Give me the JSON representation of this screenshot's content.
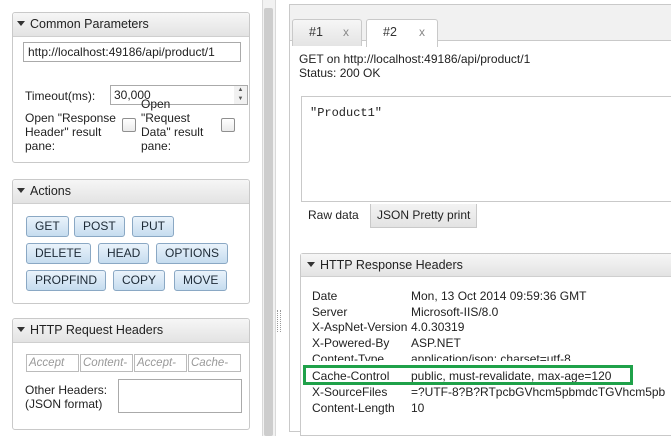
{
  "common": {
    "title": "Common Parameters",
    "url_value": "http://localhost:49186/api/product/1",
    "timeout_label": "Timeout(ms):",
    "timeout_value": "30,000",
    "open_response_header_label": [
      "Open \"Response",
      "Header\" result",
      "pane:"
    ],
    "open_request_data_label": [
      "Open",
      "\"Request",
      "Data\" result",
      "pane:"
    ]
  },
  "actions": {
    "title": "Actions",
    "buttons": [
      "GET",
      "POST",
      "PUT",
      "DELETE",
      "HEAD",
      "OPTIONS",
      "PROPFIND",
      "COPY",
      "MOVE"
    ]
  },
  "request_headers": {
    "title": "HTTP Request Headers",
    "header_placeholders": [
      "Accept",
      "Content-",
      "Accept-",
      "Cache-"
    ],
    "other_headers_label": [
      "Other Headers:",
      "(JSON format)"
    ]
  },
  "tabs": [
    {
      "label": "#1",
      "close": "x"
    },
    {
      "label": "#2",
      "close": "x"
    }
  ],
  "response": {
    "request_line": "GET on http://localhost:49186/api/product/1",
    "status": "Status: 200 OK",
    "body": "\"Product1\"",
    "view_tabs": [
      "Raw data",
      "JSON Pretty print"
    ]
  },
  "response_headers": {
    "title": "HTTP Response Headers",
    "rows": [
      {
        "name": "Date",
        "value": "Mon, 13 Oct 2014 09:59:36 GMT"
      },
      {
        "name": "Server",
        "value": "Microsoft-IIS/8.0"
      },
      {
        "name": "X-AspNet-Version",
        "value": "4.0.30319"
      },
      {
        "name": "X-Powered-By",
        "value": "ASP.NET"
      },
      {
        "name": "Content-Type",
        "value": "application/json; charset=utf-8"
      },
      {
        "name": "Cache-Control",
        "value": "public, must-revalidate, max-age=120"
      },
      {
        "name": "X-SourceFiles",
        "value": "=?UTF-8?B?RTpcbGVhcm5pbmdcTGVhcm5pb"
      },
      {
        "name": "Content-Length",
        "value": "10"
      }
    ],
    "highlight_color": "#1fa149"
  }
}
